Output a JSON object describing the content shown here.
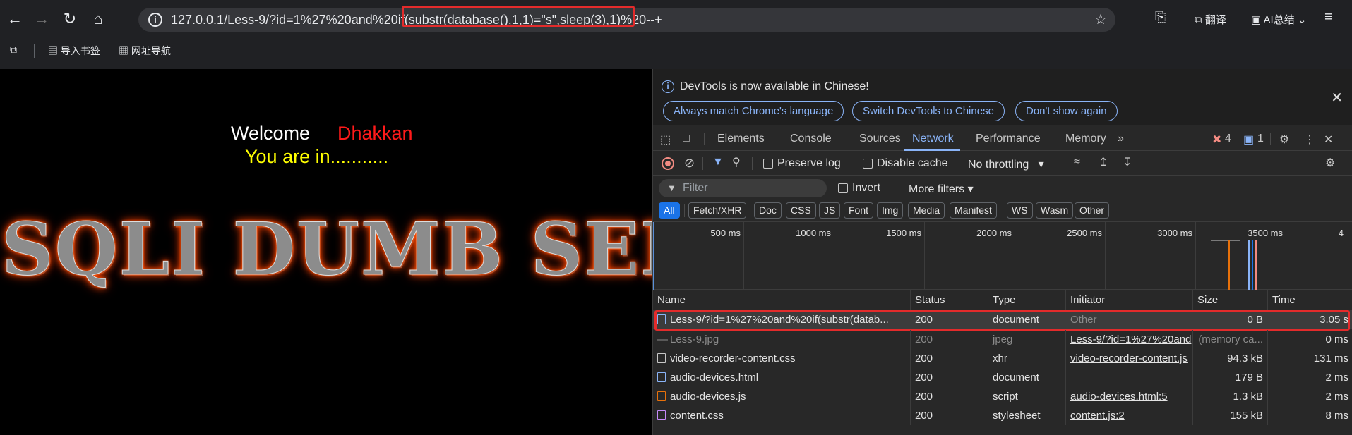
{
  "browser": {
    "url": "127.0.0.1/Less-9/?id=1%27%20and%20if(substr(database(),1,1)=\"s\",sleep(3),1)%20--+",
    "translate_label": "翻译",
    "ai_label": "AI总结",
    "bookmarks": [
      "导入书签",
      "网址导航"
    ]
  },
  "page": {
    "welcome": "Welcome",
    "name": "Dhakkan",
    "status": "You are in...........",
    "banner": "SQLI DUMB SERIES"
  },
  "devtools": {
    "info_message": "DevTools is now available in Chinese!",
    "buttons": [
      "Always match Chrome's language",
      "Switch DevTools to Chinese",
      "Don't show again"
    ],
    "tabs": [
      "Elements",
      "Console",
      "Sources",
      "Network",
      "Performance",
      "Memory"
    ],
    "active_tab": "Network",
    "error_count": "4",
    "message_count": "1",
    "preserve_log": "Preserve log",
    "disable_cache": "Disable cache",
    "throttling": "No throttling",
    "filter_placeholder": "Filter",
    "invert": "Invert",
    "more_filters": "More filters",
    "type_filters": [
      "All",
      "Fetch/XHR",
      "Doc",
      "CSS",
      "JS",
      "Font",
      "Img",
      "Media",
      "Manifest",
      "WS",
      "Wasm",
      "Other"
    ],
    "timeline_labels": [
      "500 ms",
      "1000 ms",
      "1500 ms",
      "2000 ms",
      "2500 ms",
      "3000 ms",
      "3500 ms",
      "4"
    ],
    "columns": [
      "Name",
      "Status",
      "Type",
      "Initiator",
      "Size",
      "Time"
    ],
    "rows": [
      {
        "name": "Less-9/?id=1%27%20and%20if(substr(datab...",
        "status": "200",
        "type": "document",
        "initiator": "Other",
        "size": "0 B",
        "time": "3.05 s"
      },
      {
        "name": "Less-9.jpg",
        "status": "200",
        "type": "jpeg",
        "initiator": "Less-9/?id=1%27%20and",
        "size": "(memory ca...",
        "time": "0 ms"
      },
      {
        "name": "video-recorder-content.css",
        "status": "200",
        "type": "xhr",
        "initiator": "video-recorder-content.js",
        "size": "94.3 kB",
        "time": "131 ms"
      },
      {
        "name": "audio-devices.html",
        "status": "200",
        "type": "document",
        "initiator": "",
        "size": "179 B",
        "time": "2 ms"
      },
      {
        "name": "audio-devices.js",
        "status": "200",
        "type": "script",
        "initiator": "audio-devices.html:5",
        "size": "1.3 kB",
        "time": "2 ms"
      },
      {
        "name": "content.css",
        "status": "200",
        "type": "stylesheet",
        "initiator": "content.js:2",
        "size": "155 kB",
        "time": "8 ms"
      }
    ]
  }
}
